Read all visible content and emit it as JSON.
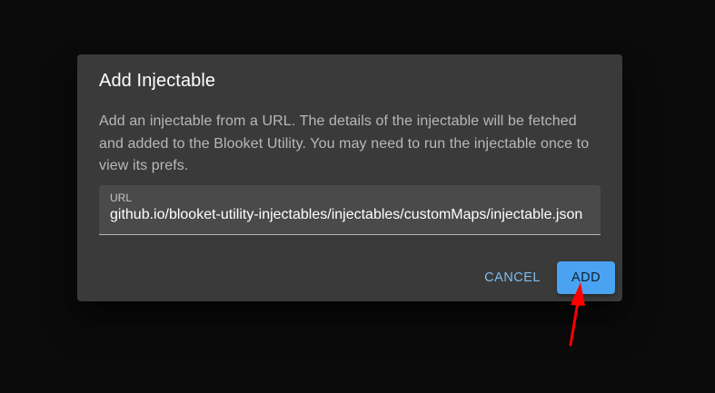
{
  "dialog": {
    "title": "Add Injectable",
    "description": "Add an injectable from a URL. The details of the injectable will be fetched and added to the Blooket Utility. You may need to run the injectable once to view its prefs.",
    "url_field": {
      "label": "URL",
      "value": "github.io/blooket-utility-injectables/injectables/customMaps/injectable.json"
    },
    "actions": {
      "cancel_label": "CANCEL",
      "add_label": "ADD"
    }
  },
  "colors": {
    "backdrop": "#0b0b0b",
    "dialog_bg": "#3a3a3a",
    "primary": "#4aa3f0",
    "annotation_arrow": "#ff0000"
  }
}
